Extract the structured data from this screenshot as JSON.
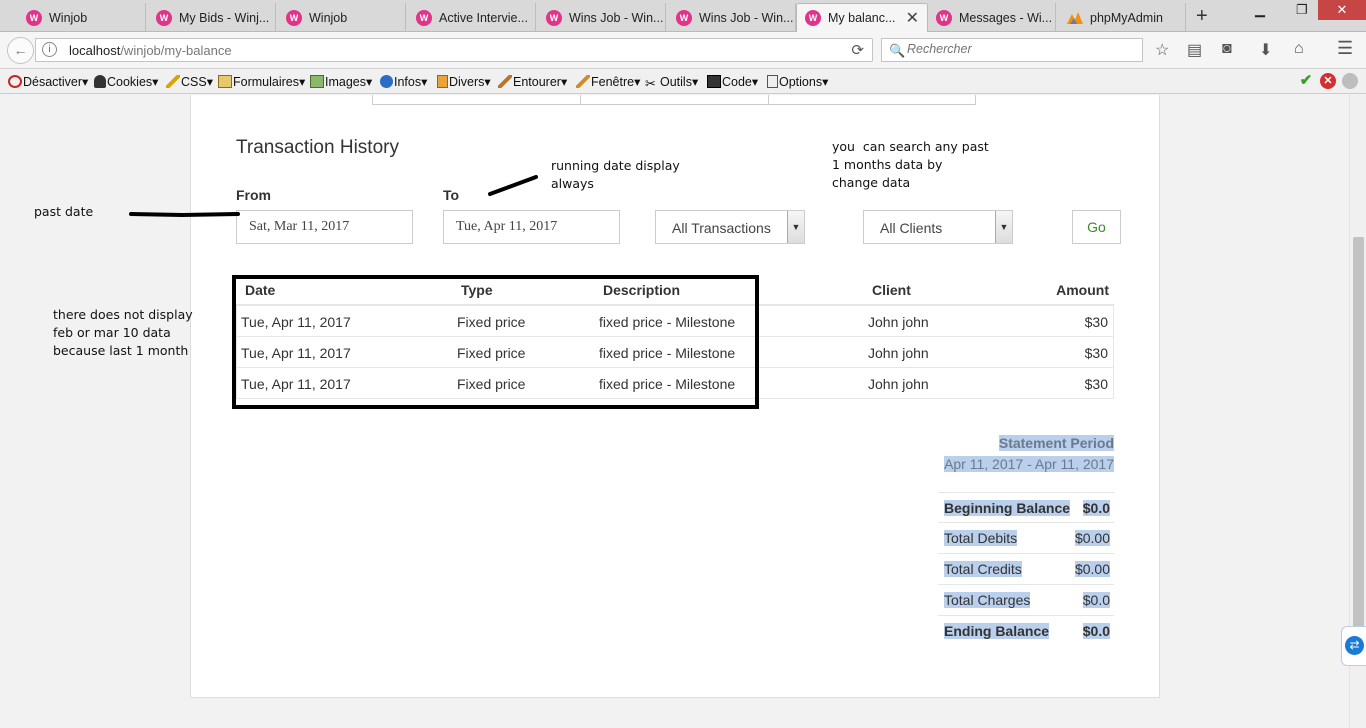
{
  "browser": {
    "tabs": [
      {
        "title": "Winjob",
        "icon": "winjob-favicon"
      },
      {
        "title": "My Bids - Winj...",
        "icon": "winjob-favicon"
      },
      {
        "title": "Winjob",
        "icon": "winjob-favicon"
      },
      {
        "title": "Active Intervie...",
        "icon": "winjob-favicon"
      },
      {
        "title": "Wins Job - Win...",
        "icon": "winjob-favicon"
      },
      {
        "title": "Wins Job - Win...",
        "icon": "winjob-favicon"
      },
      {
        "title": "My balanc...",
        "icon": "winjob-favicon",
        "active": true
      },
      {
        "title": "Messages - Wi...",
        "icon": "winjob-favicon"
      },
      {
        "title": "phpMyAdmin",
        "icon": "phpmyadmin-favicon"
      }
    ],
    "url": {
      "host": "localhost",
      "path": "/winjob/my-balance"
    },
    "search_placeholder": "Rechercher",
    "devtoolbar": [
      "Désactiver▾",
      "Cookies▾",
      "CSS▾",
      "Formulaires▾",
      "Images▾",
      "Infos▾",
      "Divers▾",
      "Entourer▾",
      "Fenêtre▾",
      "Outils▾",
      "Code▾",
      "Options▾"
    ]
  },
  "page": {
    "section_title": "Transaction History",
    "from_label": "From",
    "to_label": "To",
    "from_value": "Sat, Mar 11, 2017",
    "to_value": "Tue, Apr 11, 2017",
    "type_filter": "All Transactions",
    "client_filter": "All Clients",
    "go_label": "Go",
    "table": {
      "headers": [
        "Date",
        "Type",
        "Description",
        "Client",
        "Amount"
      ],
      "rows": [
        [
          "Tue, Apr 11, 2017",
          "Fixed price",
          "fixed price - Milestone",
          "John john",
          "$30"
        ],
        [
          "Tue, Apr 11, 2017",
          "Fixed price",
          "fixed price - Milestone",
          "John john",
          "$30"
        ],
        [
          "Tue, Apr 11, 2017",
          "Fixed price",
          "fixed price - Milestone",
          "John john",
          "$30"
        ]
      ]
    },
    "statement": {
      "title": "Statement Period",
      "period": "Apr 11, 2017 - Apr 11, 2017",
      "rows": [
        {
          "label": "Beginning Balance",
          "value": "$0.0",
          "bold": true
        },
        {
          "label": "Total Debits",
          "value": "$0.00",
          "bold": false
        },
        {
          "label": "Total Credits",
          "value": "$0.00",
          "bold": false
        },
        {
          "label": "Total Charges",
          "value": "$0.0",
          "bold": false
        },
        {
          "label": "Ending Balance",
          "value": "$0.0",
          "bold": true
        }
      ]
    }
  },
  "annotations": {
    "past_date": "past date",
    "running_date": [
      "running date display",
      "always"
    ],
    "search_note": [
      "you  can search any past",
      "1 months data by",
      "change data"
    ],
    "no_display": [
      "there does not display",
      "feb or mar 10 data",
      "because last 1 month"
    ]
  }
}
